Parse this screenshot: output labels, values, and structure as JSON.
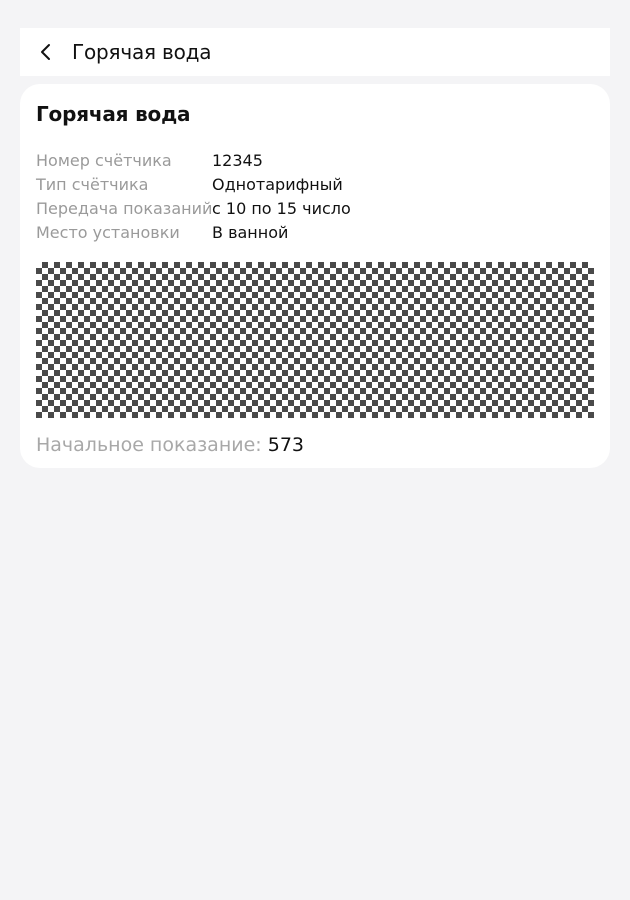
{
  "header": {
    "title": "Горячая вода",
    "back_icon": "chevron-left-icon"
  },
  "card": {
    "title": "Горячая вода",
    "rows": [
      {
        "label": "Номер счётчика",
        "value": "12345"
      },
      {
        "label": "Тип счётчика",
        "value": "Однотарифный"
      },
      {
        "label": "Передача показаний",
        "value": "с 10 по 15 число"
      },
      {
        "label": "Место установки",
        "value": "В ванной"
      }
    ],
    "initial_reading_label": "Начальное показание:",
    "initial_reading_value": "573"
  },
  "colors": {
    "background": "#f4f4f6",
    "card": "#ffffff",
    "label": "#9a9a9a",
    "text": "#111111"
  }
}
